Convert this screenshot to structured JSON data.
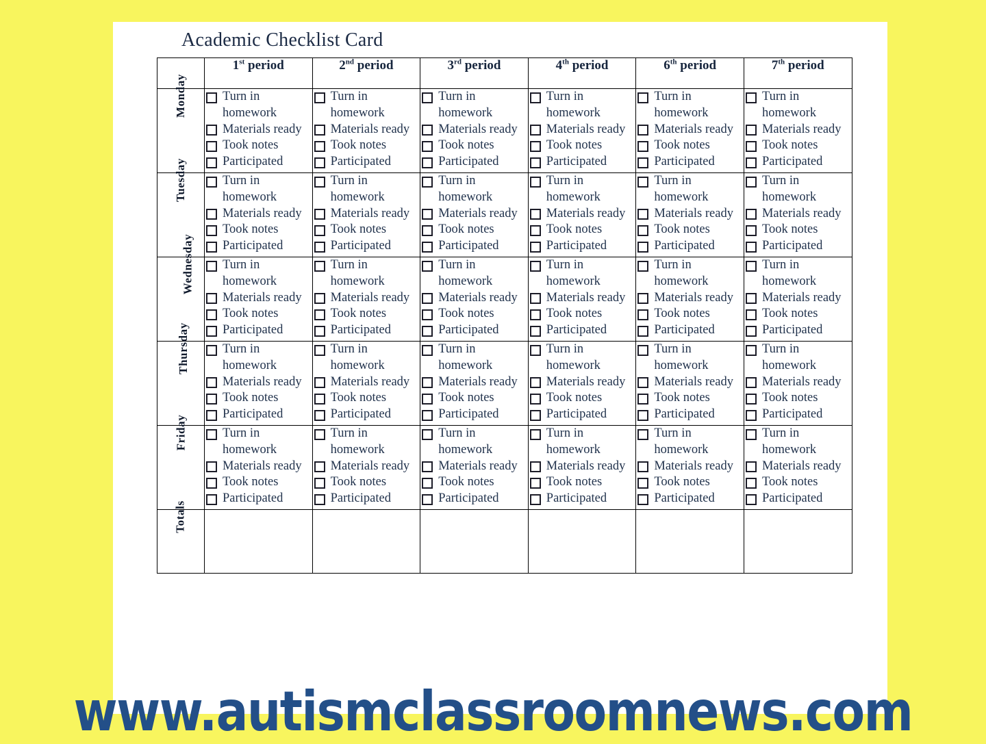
{
  "page": {
    "background_color": "#f8f55e",
    "card_background_color": "#ffffff",
    "watermark": "www.autismclassroomnews.com",
    "watermark_color": "#234f88"
  },
  "card": {
    "title": "Academic Checklist Card"
  },
  "table": {
    "corner_header": "",
    "column_headers": [
      {
        "ordinal": "1",
        "suffix": "st",
        "label": "period"
      },
      {
        "ordinal": "2",
        "suffix": "nd",
        "label": "period"
      },
      {
        "ordinal": "3",
        "suffix": "rd",
        "label": "period"
      },
      {
        "ordinal": "4",
        "suffix": "th",
        "label": "period"
      },
      {
        "ordinal": "6",
        "suffix": "th",
        "label": "period"
      },
      {
        "ordinal": "7",
        "suffix": "th",
        "label": "period"
      }
    ],
    "checklist_items": [
      "Turn in homework",
      "Materials ready",
      "Took notes",
      "Participated"
    ],
    "rows": [
      {
        "day": "Monday",
        "type": "checklist"
      },
      {
        "day": "Tuesday",
        "type": "checklist"
      },
      {
        "day": "Wednesday",
        "type": "checklist"
      },
      {
        "day": "Thursday",
        "type": "checklist"
      },
      {
        "day": "Friday",
        "type": "checklist"
      },
      {
        "day": "Totals",
        "type": "blank"
      }
    ]
  }
}
